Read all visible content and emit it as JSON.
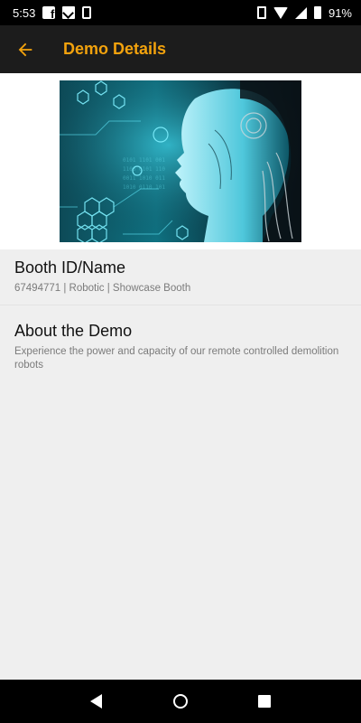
{
  "status_bar": {
    "time": "5:53",
    "battery": "91%"
  },
  "app_bar": {
    "title": "Demo Details"
  },
  "booth": {
    "title": "Booth ID/Name",
    "subtitle": "67494771 | Robotic | Showcase Booth"
  },
  "about": {
    "title": "About the Demo",
    "description": "Experience the power and capacity of our remote controlled demolition robots"
  },
  "colors": {
    "accent": "#f2a20d",
    "app_bar_bg": "#1c1c1c",
    "page_bg": "#efefef"
  },
  "icons": {
    "back": "arrow-left-icon",
    "nav_back": "triangle-back-icon",
    "nav_home": "circle-home-icon",
    "nav_recent": "square-recent-icon"
  }
}
